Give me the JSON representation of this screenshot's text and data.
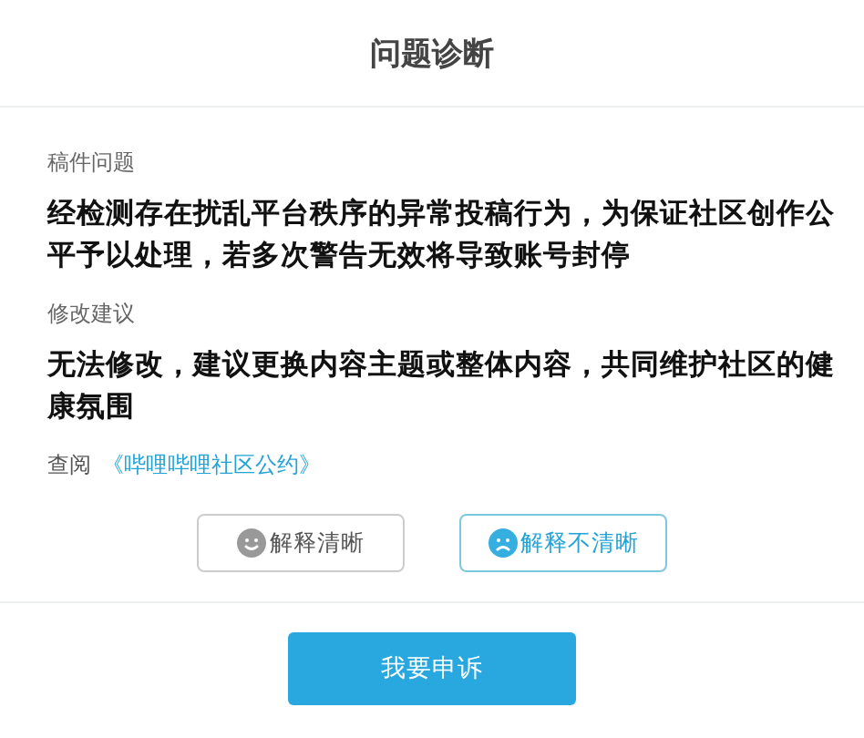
{
  "dialog": {
    "title": "问题诊断"
  },
  "sections": [
    {
      "label": "稿件问题",
      "text": "经检测存在扰乱平台秩序的异常投稿行为，为保证社区创作公平予以处理，若多次警告无效将导致账号封停"
    },
    {
      "label": "修改建议",
      "text": "无法修改，建议更换内容主题或整体内容，共同维护社区的健康氛围"
    }
  ],
  "reference": {
    "prefix": "查阅",
    "link": "《哔哩哔哩社区公约》"
  },
  "feedback": [
    {
      "kind": "happy",
      "label": "解释清晰",
      "selected": false
    },
    {
      "kind": "sad",
      "label": "解释不清晰",
      "selected": true
    }
  ],
  "appeal_button": "我要申诉"
}
